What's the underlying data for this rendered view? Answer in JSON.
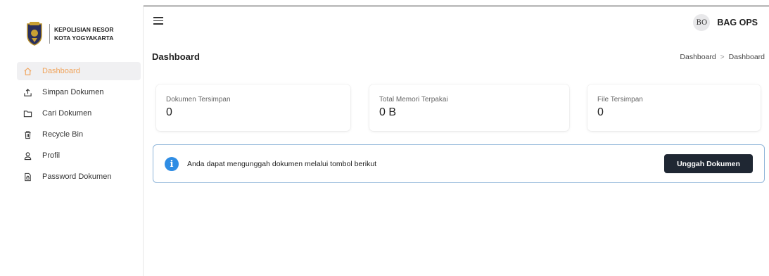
{
  "brand": {
    "line1": "KEPOLISIAN RESOR",
    "line2": "KOTA YOGYAKARTA"
  },
  "sidebar": {
    "items": [
      {
        "label": "Dashboard",
        "icon": "home-icon",
        "active": true
      },
      {
        "label": "Simpan Dokumen",
        "icon": "upload-icon",
        "active": false
      },
      {
        "label": "Cari Dokumen",
        "icon": "folder-icon",
        "active": false
      },
      {
        "label": "Recycle Bin",
        "icon": "trash-icon",
        "active": false
      },
      {
        "label": "Profil",
        "icon": "user-icon",
        "active": false
      },
      {
        "label": "Password Dokumen",
        "icon": "file-lock-icon",
        "active": false
      }
    ]
  },
  "header": {
    "avatar_initials": "BO",
    "username": "BAG OPS"
  },
  "page": {
    "title": "Dashboard",
    "breadcrumb": [
      "Dashboard",
      "Dashboard"
    ]
  },
  "stats": [
    {
      "label": "Dokumen Tersimpan",
      "value": "0"
    },
    {
      "label": "Total Memori Terpakai",
      "value": "0 B"
    },
    {
      "label": "File Tersimpan",
      "value": "0"
    }
  ],
  "info": {
    "text": "Anda dapat mengunggah dokumen melalui tombol berikut",
    "button_label": "Unggah Dokumen"
  },
  "colors": {
    "accent": "#f0a35a",
    "info": "#2f8de4",
    "button": "#1f2733"
  }
}
